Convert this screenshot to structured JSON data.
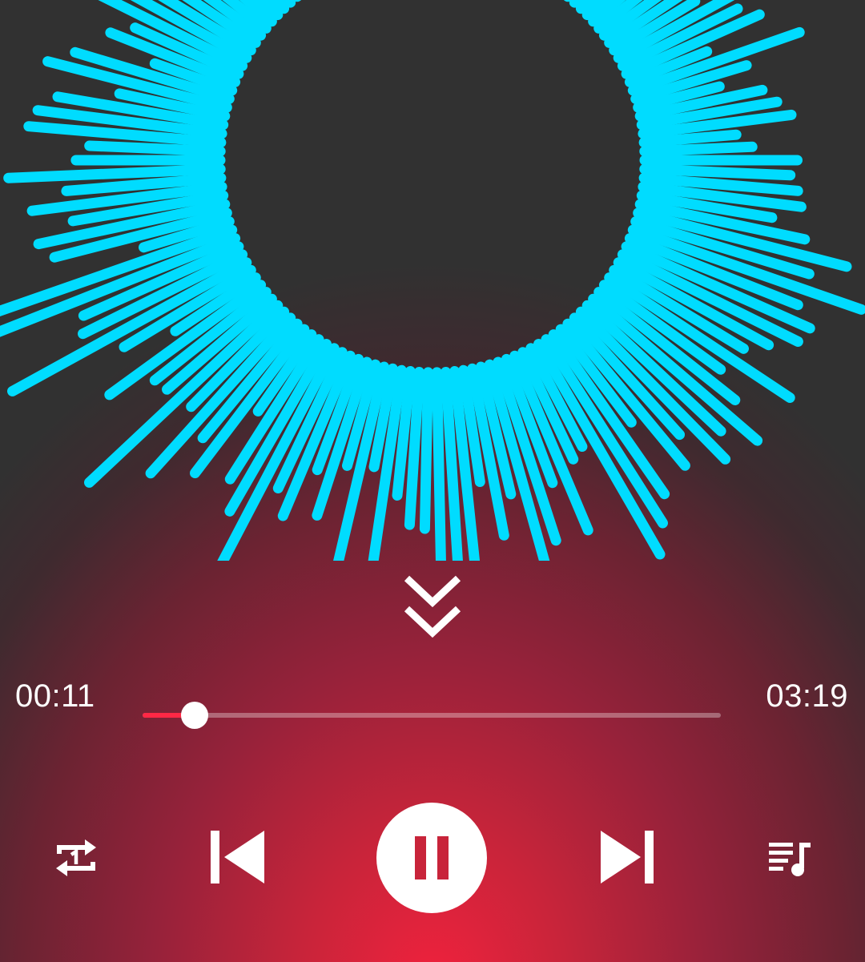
{
  "player": {
    "elapsed": "00:11",
    "duration": "03:19",
    "progress_fraction": 0.059,
    "state": "playing"
  },
  "icons": {
    "collapse": "double-chevron-down-icon",
    "repeat": "repeat-one-icon",
    "previous": "skip-previous-icon",
    "play_pause": "pause-icon",
    "next": "skip-next-icon",
    "queue": "playlist-icon"
  },
  "colors": {
    "visualizer": "#00dcff",
    "accent": "#ff2845",
    "foreground": "#ffffff",
    "background_top": "#313131",
    "background_bottom": "#f0223d"
  }
}
